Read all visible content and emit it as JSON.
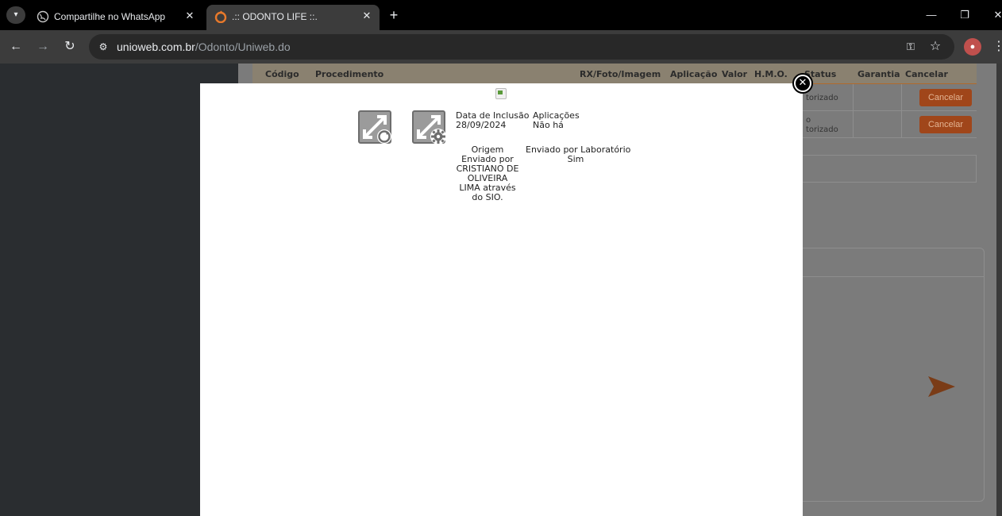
{
  "browser": {
    "tabs": [
      {
        "title": "Compartilhe no WhatsApp",
        "active": false,
        "favicon": "globe-icon"
      },
      {
        "title": ".:: ODONTO LIFE ::.",
        "active": true,
        "favicon": "odonto-logo-icon"
      }
    ],
    "url_host": "unioweb.com.br",
    "url_path": "/Odonto/Uniweb.do"
  },
  "table": {
    "headers": [
      "Código",
      "Procedimento",
      "RX/Foto/Imagem",
      "Aplicação",
      "Valor",
      "H.M.O.",
      "Status",
      "Garantia",
      "Cancelar"
    ],
    "rows": [
      {
        "status": "torizado",
        "status_line1": "",
        "cancel_label": "Cancelar"
      },
      {
        "status": "torizado",
        "status_line1": "o",
        "cancel_label": "Cancelar"
      }
    ]
  },
  "modal": {
    "data_inclusao_label": "Data de Inclusão",
    "data_inclusao_value": "28/09/2024",
    "aplicacoes_label": "Aplicações",
    "aplicacoes_value": "Não há",
    "origem_label": "Origem",
    "origem_lines": [
      "Enviado por",
      "CRISTIANO DE",
      "OLIVEIRA",
      "LIMA através",
      "do SIO."
    ],
    "laboratorio_label": "Enviado por Laboratório",
    "laboratorio_value": "Sim"
  },
  "colors": {
    "accent_orange": "#d45d1e",
    "modal_bg": "#ffffff",
    "overlay_dim": "#7b7b7b"
  }
}
